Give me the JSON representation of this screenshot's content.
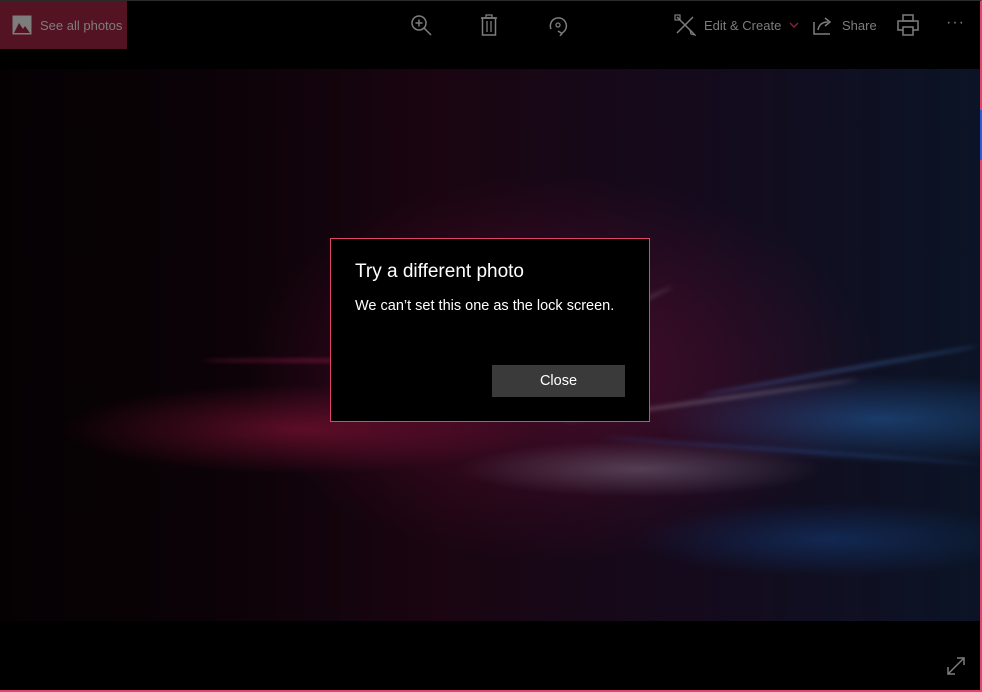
{
  "toolbar": {
    "see_all_photos": "See all photos",
    "icons": [
      "zoom-in-icon",
      "delete-icon",
      "rotate-icon"
    ],
    "edit_create": "Edit & Create",
    "share": "Share",
    "print_icon": "printer-icon",
    "more_icon": "more-icon",
    "more_glyph": "···"
  },
  "colors": {
    "accent": "#e0436b",
    "see_all_bg": "#531323",
    "toolbar_text": "#7d7d7d",
    "dialog_button_bg": "#3a3a3a"
  },
  "dialog": {
    "title": "Try a different photo",
    "message": "We can’t set this one as the lock screen.",
    "close_label": "Close"
  },
  "footer": {
    "expand_icon": "fullscreen-expand-icon"
  }
}
